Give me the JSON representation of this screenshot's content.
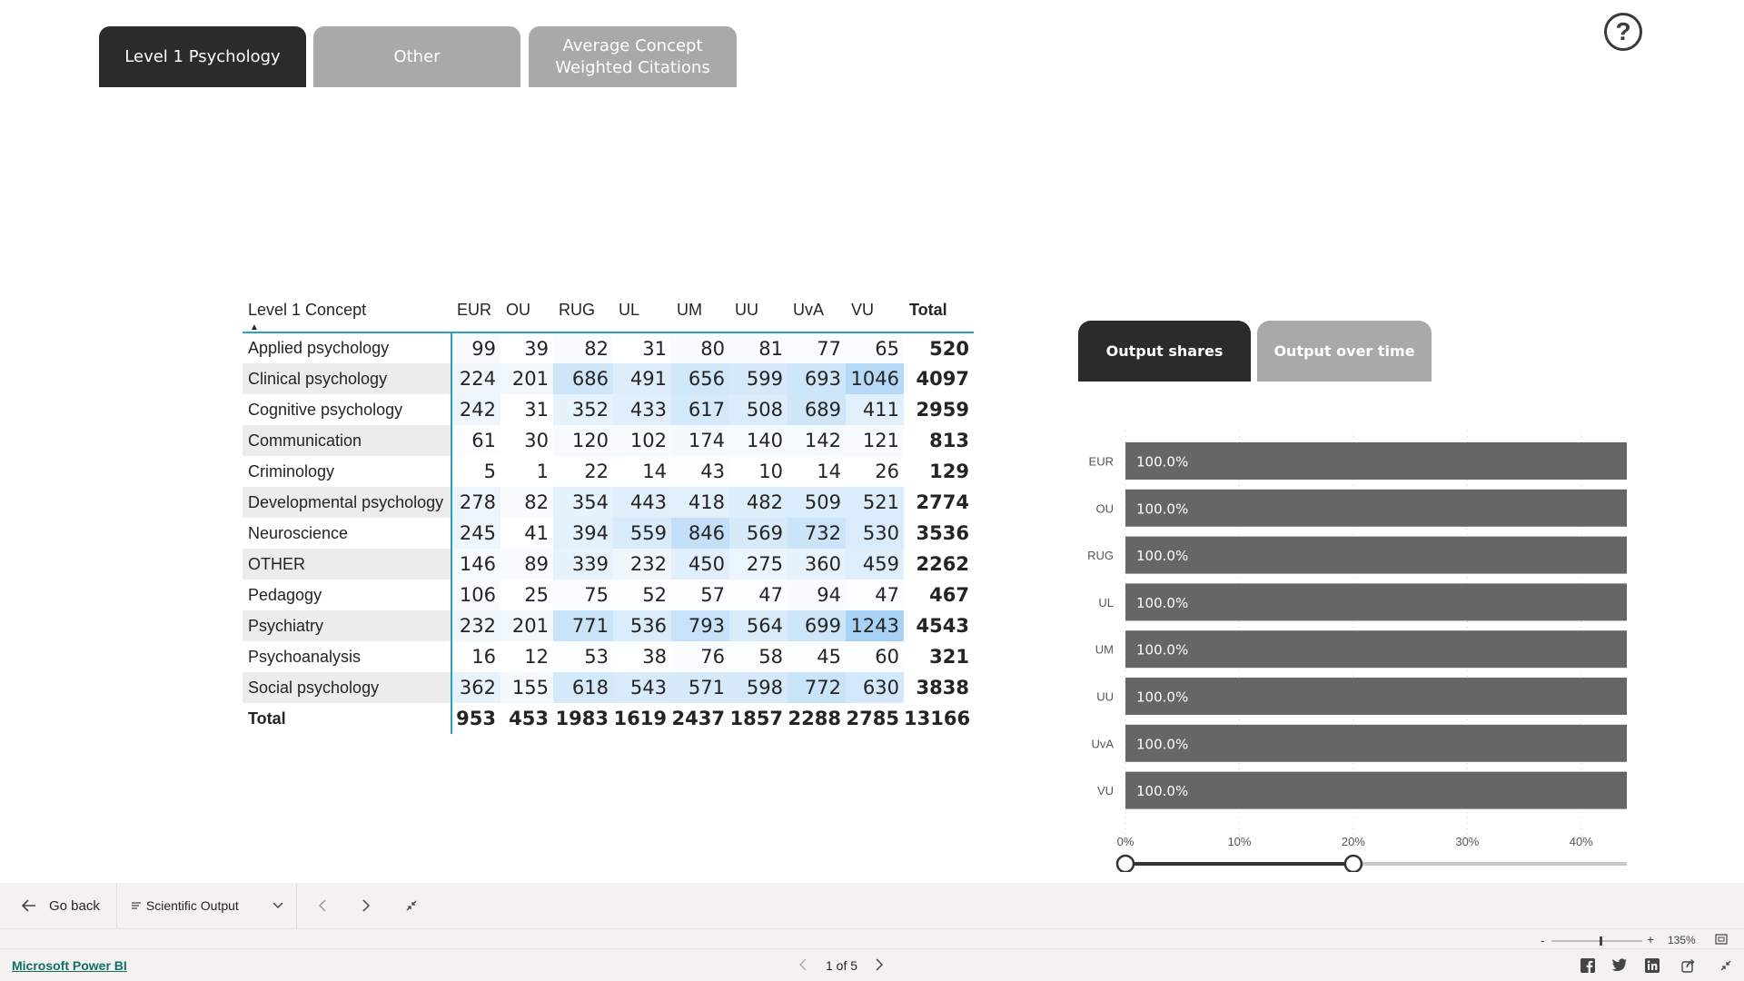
{
  "tabs": [
    {
      "label": "Level 1 Psychology",
      "active": true
    },
    {
      "label": "Other",
      "active": false
    },
    {
      "label": "Average Concept Weighted Citations",
      "active": false
    }
  ],
  "help_icon": "question-circle-icon",
  "matrix": {
    "row_header": "Level 1 Concept",
    "columns": [
      "EUR",
      "OU",
      "RUG",
      "UL",
      "UM",
      "UU",
      "UvA",
      "VU",
      "Total"
    ],
    "rows": [
      {
        "label": "Applied psychology",
        "values": [
          99,
          39,
          82,
          31,
          80,
          81,
          77,
          65,
          520
        ]
      },
      {
        "label": "Clinical psychology",
        "values": [
          224,
          201,
          686,
          491,
          656,
          599,
          693,
          1046,
          4097
        ]
      },
      {
        "label": "Cognitive psychology",
        "values": [
          242,
          31,
          352,
          433,
          617,
          508,
          689,
          411,
          2959
        ]
      },
      {
        "label": "Communication",
        "values": [
          61,
          30,
          120,
          102,
          174,
          140,
          142,
          121,
          813
        ]
      },
      {
        "label": "Criminology",
        "values": [
          5,
          1,
          22,
          14,
          43,
          10,
          14,
          26,
          129
        ]
      },
      {
        "label": "Developmental psychology",
        "values": [
          278,
          82,
          354,
          443,
          418,
          482,
          509,
          521,
          2774
        ]
      },
      {
        "label": "Neuroscience",
        "values": [
          245,
          41,
          394,
          559,
          846,
          569,
          732,
          530,
          3536
        ]
      },
      {
        "label": "OTHER",
        "values": [
          146,
          89,
          339,
          232,
          450,
          275,
          360,
          459,
          2262
        ]
      },
      {
        "label": "Pedagogy",
        "values": [
          106,
          25,
          75,
          52,
          57,
          47,
          94,
          47,
          467
        ]
      },
      {
        "label": "Psychiatry",
        "values": [
          232,
          201,
          771,
          536,
          793,
          564,
          699,
          1243,
          4543
        ]
      },
      {
        "label": "Psychoanalysis",
        "values": [
          16,
          12,
          53,
          38,
          76,
          58,
          45,
          60,
          321
        ]
      },
      {
        "label": "Social psychology",
        "values": [
          362,
          155,
          618,
          543,
          571,
          598,
          772,
          630,
          3838
        ]
      }
    ],
    "total_row": {
      "label": "Total",
      "values": [
        953,
        453,
        1983,
        1619,
        2437,
        1857,
        2288,
        2785,
        13166
      ]
    }
  },
  "right_tabs": [
    {
      "label": "Output shares",
      "active": true
    },
    {
      "label": "Output over time",
      "active": false
    }
  ],
  "chart_data": {
    "type": "bar",
    "orientation": "horizontal",
    "categories": [
      "EUR",
      "OU",
      "RUG",
      "UL",
      "UM",
      "UU",
      "UvA",
      "VU"
    ],
    "values": [
      100.0,
      100.0,
      100.0,
      100.0,
      100.0,
      100.0,
      100.0,
      100.0
    ],
    "data_labels": [
      "100.0%",
      "100.0%",
      "100.0%",
      "100.0%",
      "100.0%",
      "100.0%",
      "100.0%",
      "100.0%"
    ],
    "x_ticks": [
      "0%",
      "10%",
      "20%",
      "30%",
      "40%"
    ],
    "xlim": [
      0,
      44
    ],
    "bar_color": "#666666",
    "range_slider": [
      0,
      20
    ]
  },
  "bottom_nav": {
    "back_label": "Go back",
    "page_select_label": "Scientific Output",
    "icons": [
      "arrow-left-icon",
      "list-icon",
      "chevron-down-icon",
      "chevron-left-icon",
      "chevron-right-icon",
      "collapse-icon"
    ]
  },
  "zoom": {
    "label": "135%"
  },
  "footer": {
    "link_label": "Microsoft Power BI",
    "page_indicator": "1 of 5",
    "icons": [
      "facebook-icon",
      "twitter-icon",
      "linkedin-icon",
      "share-icon",
      "collapse-icon"
    ]
  }
}
